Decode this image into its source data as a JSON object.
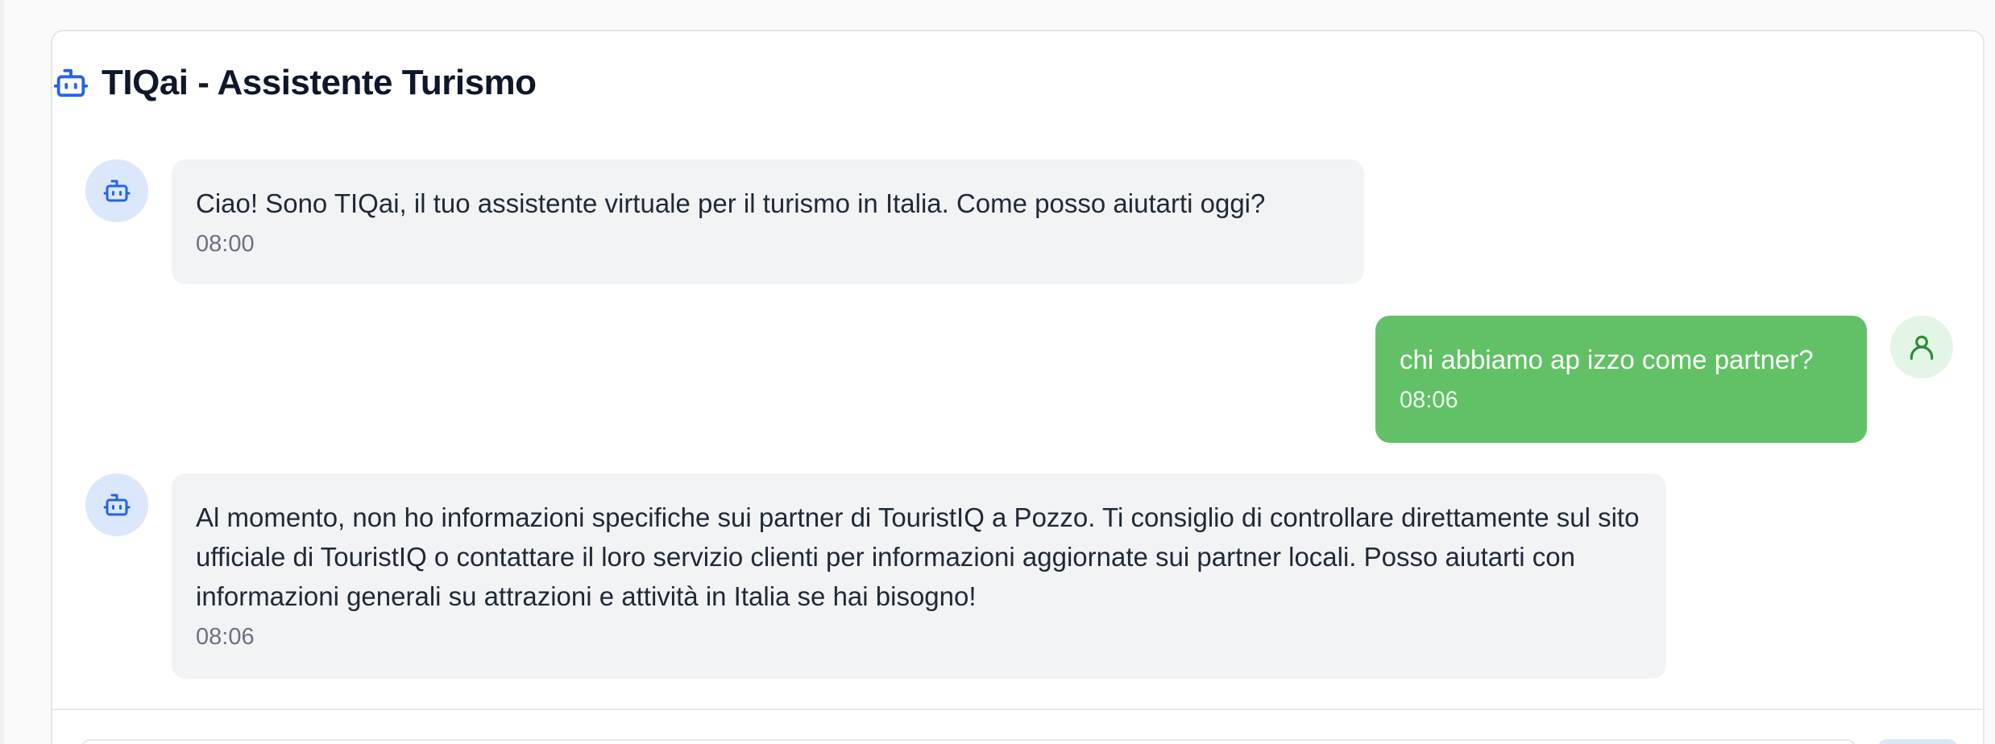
{
  "header": {
    "title": "TIQai - Assistente Turismo",
    "icon": "bot-icon"
  },
  "colors": {
    "accent": "#2563eb",
    "user_bubble": "#62c166",
    "bot_bubble": "#f2f3f5"
  },
  "messages": [
    {
      "sender": "bot",
      "text": "Ciao! Sono TIQai, il tuo assistente virtuale per il turismo in Italia. Come posso aiutarti oggi?",
      "time": "08:00"
    },
    {
      "sender": "user",
      "text": "chi abbiamo ap izzo come partner?",
      "time": "08:06"
    },
    {
      "sender": "bot",
      "text": "Al momento, non ho informazioni specifiche sui partner di TouristIQ a Pozzo. Ti consiglio di controllare direttamente sul sito ufficiale di TouristIQ o contattare il loro servizio clienti per informazioni aggiornate sui partner locali. Posso aiutarti con informazioni generali su attrazioni e attività in Italia se hai bisogno!",
      "time": "08:06"
    }
  ]
}
